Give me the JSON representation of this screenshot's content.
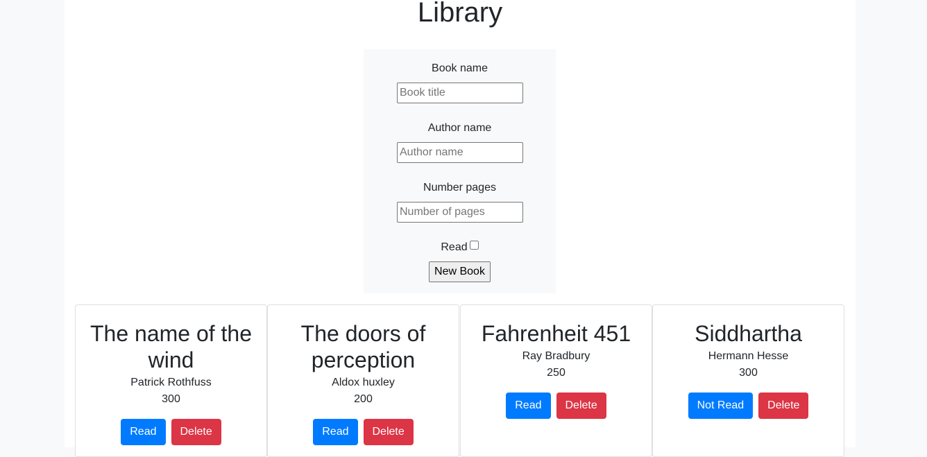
{
  "page": {
    "title": "Library"
  },
  "form": {
    "book_label": "Book name",
    "book_placeholder": "Book title",
    "author_label": "Author name",
    "author_placeholder": "Author name",
    "pages_label": "Number pages",
    "pages_placeholder": "Number of pages",
    "read_label": "Read",
    "read_checked": false,
    "submit_label": "New Book"
  },
  "books": [
    {
      "title": "The name of the wind",
      "author": "Patrick Rothfuss",
      "pages": "300",
      "status_label": "Read",
      "delete_label": "Delete"
    },
    {
      "title": "The doors of perception",
      "author": "Aldox huxley",
      "pages": "200",
      "status_label": "Read",
      "delete_label": "Delete"
    },
    {
      "title": "Fahrenheit 451",
      "author": "Ray Bradbury",
      "pages": "250",
      "status_label": "Read",
      "delete_label": "Delete"
    },
    {
      "title": "Siddhartha",
      "author": "Hermann Hesse",
      "pages": "300",
      "status_label": "Not Read",
      "delete_label": "Delete"
    }
  ],
  "colors": {
    "primary": "#007bff",
    "danger": "#dc3545",
    "background": "#f8f9fa"
  }
}
